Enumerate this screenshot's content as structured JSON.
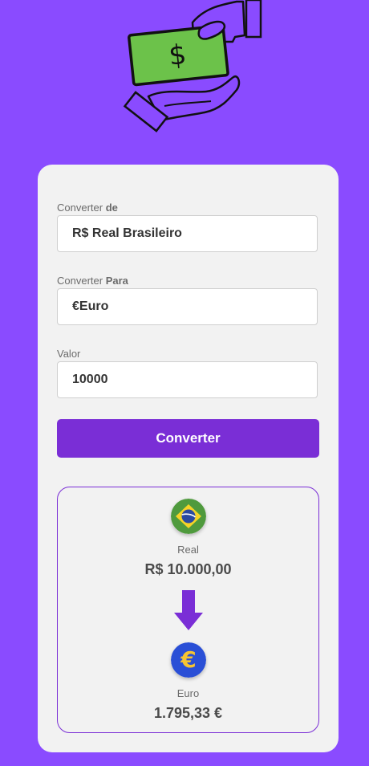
{
  "form": {
    "from_label_prefix": "Converter",
    "from_label_bold": "de",
    "from_value": "R$ Real Brasileiro",
    "to_label_prefix": "Converter",
    "to_label_bold": "Para",
    "to_value": "€Euro",
    "amount_label": "Valor",
    "amount_value": "10000",
    "convert_button": "Converter"
  },
  "result": {
    "from_currency_name": "Real",
    "from_amount": "R$ 10.000,00",
    "to_currency_name": "Euro",
    "to_amount": "1.795,33 €",
    "from_icon": "brazil-flag-icon",
    "to_icon": "euro-coin-icon",
    "direction_icon": "arrow-down-icon"
  },
  "colors": {
    "background": "#8a4bff",
    "card": "#f2f2f2",
    "accent": "#7a2ed6",
    "money_green": "#6cc24a"
  }
}
